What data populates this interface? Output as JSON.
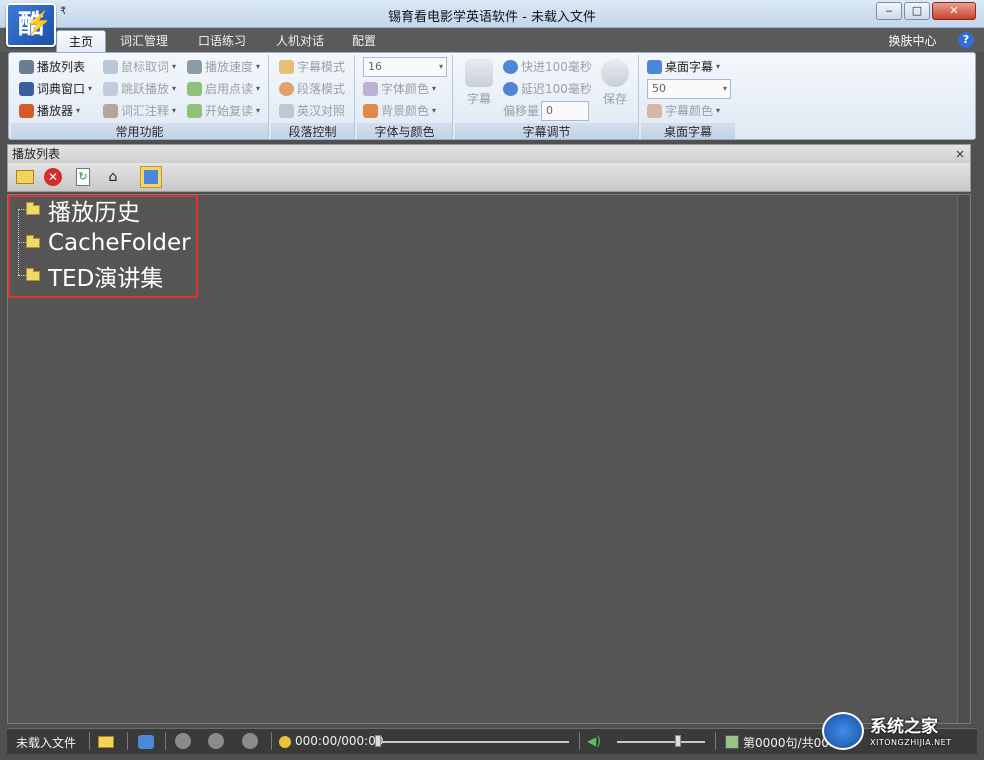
{
  "window": {
    "title": "锡育看电影学英语软件 - 未载入文件",
    "logo_text": "酷",
    "min": "0",
    "max": "□",
    "close": "X"
  },
  "menu": {
    "tabs": [
      "主页",
      "词汇管理",
      "口语练习",
      "人机对话",
      "配置"
    ],
    "skin": "换肤中心",
    "help": "?"
  },
  "ribbon": {
    "common": {
      "label": "常用功能",
      "items": [
        "播放列表",
        "词典窗口",
        "播放器",
        "鼠标取词",
        "跳跃播放",
        "词汇注释",
        "播放速度",
        "启用点读",
        "开始复读"
      ]
    },
    "paragraph": {
      "label": "段落控制",
      "items": [
        "字幕模式",
        "段落模式",
        "英汉对照"
      ]
    },
    "font": {
      "label": "字体与颜色",
      "size": "16",
      "items": [
        "字体颜色",
        "背景颜色"
      ]
    },
    "subtitle_adjust": {
      "label": "字幕调节",
      "caption": "字幕",
      "fast": "快进100毫秒",
      "delay": "延迟100毫秒",
      "offset_label": "偏移量",
      "offset_value": "0",
      "save": "保存"
    },
    "desktop": {
      "label": "桌面字幕",
      "title": "桌面字幕",
      "size": "50",
      "color": "字幕颜色"
    }
  },
  "panel": {
    "title": "播放列表",
    "close": "×"
  },
  "tree": {
    "nodes": [
      "播放历史",
      "CacheFolder",
      "TED演讲集"
    ]
  },
  "status": {
    "file": "未载入文件",
    "time": "000:00/000:00",
    "sentence": "第0000句/共000"
  },
  "watermark": {
    "text": "系统之家",
    "sub": "XITONGZHIJIA.NET"
  },
  "colors": {
    "highlight": "#e03030",
    "background": "#555555"
  }
}
